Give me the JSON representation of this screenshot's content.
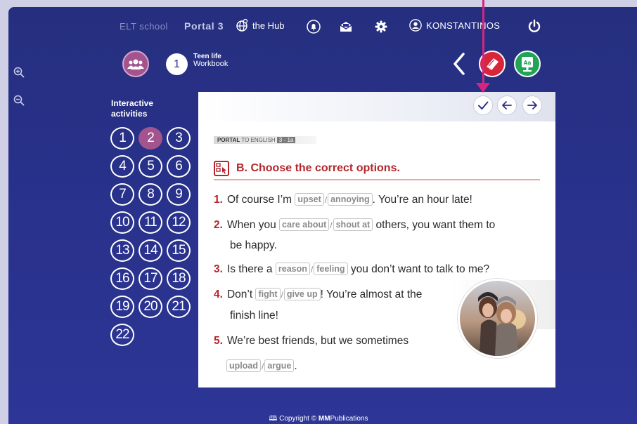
{
  "zoom": {
    "in_icon": "zoom-in-icon",
    "out_icon": "zoom-out-icon"
  },
  "topbar": {
    "brand": "ELT school",
    "portal": "Portal 3",
    "hub": "the Hub",
    "user": "KONSTANTINOS"
  },
  "unit": {
    "number": "1",
    "title": "Teen life",
    "subtitle": "Workbook"
  },
  "activities": {
    "title_line1": "Interactive",
    "title_line2": "activities",
    "active": "2",
    "items": [
      "1",
      "2",
      "3",
      "4",
      "5",
      "6",
      "7",
      "8",
      "9",
      "10",
      "11",
      "12",
      "13",
      "14",
      "15",
      "16",
      "17",
      "18",
      "19",
      "20",
      "21",
      "22"
    ]
  },
  "exercise": {
    "tag_brand": "PORTAL",
    "tag_text": "TO ENGLISH",
    "tag_page": "3 - 1a",
    "label": "B.  Choose the correct options.",
    "items": [
      {
        "n": "1.",
        "pre": "Of course I’m",
        "opt1": "upset",
        "opt2": "annoying",
        "post": ". You’re an hour late!"
      },
      {
        "n": "2.",
        "pre": "When you",
        "opt1": "care about",
        "opt2": "shout at",
        "post": "others, you want them to",
        "line2": "be happy."
      },
      {
        "n": "3.",
        "pre": "Is there a",
        "opt1": "reason",
        "opt2": "feeling",
        "post": "you don’t want to talk to me?"
      },
      {
        "n": "4.",
        "pre": "Don’t",
        "opt1": "fight",
        "opt2": "give up",
        "post": "! You’re almost at the",
        "line2": "finish line!"
      },
      {
        "n": "5.",
        "pre": "We’re best friends, but we sometimes",
        "opt1": "upload",
        "opt2": "argue",
        "post": "."
      }
    ]
  },
  "footer": {
    "prefix": "Copyright ©",
    "brand": "MM",
    "suffix": "Publications"
  },
  "colors": {
    "accent": "#a3548f",
    "background": "#28318a",
    "red": "#b3262c",
    "pointer": "#d6247f"
  }
}
